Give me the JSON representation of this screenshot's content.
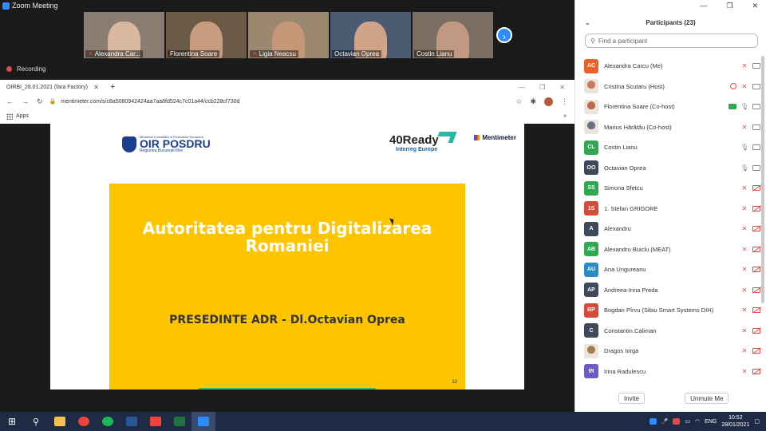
{
  "window": {
    "title": "Zoom Meeting"
  },
  "thumbnails": [
    {
      "name": "Alexandra Car...",
      "muted": true,
      "bg": "#8a7d70",
      "face": "#d9b8a0"
    },
    {
      "name": "Florentina Soare",
      "muted": false,
      "bg": "#6b5a48",
      "face": "#c89c7e"
    },
    {
      "name": "Ligia Neacsu",
      "muted": true,
      "bg": "#9c8870",
      "face": "#c49876"
    },
    {
      "name": "Octavian Oprea",
      "muted": false,
      "bg": "#4a5a70",
      "face": "#d0a489"
    },
    {
      "name": "Costin Lianu",
      "muted": false,
      "bg": "#7a6e62",
      "face": "#c09a80"
    }
  ],
  "recording": {
    "label": "Recording"
  },
  "browser": {
    "tab_title": "OIRBI_28.01.2021 (fara Factory)",
    "url": "mentimeter.com/s/c8a5080942424aa7aa8fd524c7c01a44/ccb228cf730d",
    "bookmarks_apps": "Apps"
  },
  "slide": {
    "oir_top": "Ministerul Investițiilor și Proiectelor Europene",
    "oir_title": "OIR POSDRU",
    "oir_sub": "Regiunea București Ilfov",
    "logo_40": "40Ready",
    "logo_40_sub": "Interreg Europe",
    "logo_menti": "Mentimeter",
    "heading_line1": "Autoritatea pentru Digitalizarea",
    "heading_line2": "Romaniei",
    "subheading": "PRESEDINTE ADR - Dl.Octavian Oprea",
    "page_number": "12"
  },
  "participants_panel": {
    "title": "Participants (23)",
    "search_placeholder": "Find a participant",
    "invite_label": "Invite",
    "unmute_label": "Unmute Me",
    "participants": [
      {
        "initials": "AC",
        "color": "#e8632b",
        "name": "Alexandra Carcu (Me)",
        "photo": false,
        "status": "muted",
        "cam": "on"
      },
      {
        "initials": "",
        "color": "#c47c5a",
        "name": "Cristina Scutaru (Host)",
        "photo": true,
        "status": "rec",
        "cam": "on"
      },
      {
        "initials": "",
        "color": "#b86b4e",
        "name": "Florentina Soare (Co-host)",
        "photo": true,
        "status": "screen",
        "cam": "on"
      },
      {
        "initials": "",
        "color": "#6a6f80",
        "name": "Marius Hărătău (Co-host)",
        "photo": true,
        "status": "muted",
        "cam": "on"
      },
      {
        "initials": "CL",
        "color": "#2fa84f",
        "name": "Costin Lianu",
        "photo": false,
        "status": "mic",
        "cam": "on"
      },
      {
        "initials": "OO",
        "color": "#3d4a5c",
        "name": "Octavian Oprea",
        "photo": false,
        "status": "mic",
        "cam": "on"
      },
      {
        "initials": "SS",
        "color": "#2fa84f",
        "name": "Simona Sfetcu",
        "photo": false,
        "status": "muted",
        "cam": "off"
      },
      {
        "initials": "1S",
        "color": "#d24b3b",
        "name": "1. Stefan GRIGORE",
        "photo": false,
        "status": "muted",
        "cam": "off"
      },
      {
        "initials": "A",
        "color": "#3d4a5c",
        "name": "Alexandru",
        "photo": false,
        "status": "muted",
        "cam": "off"
      },
      {
        "initials": "AB",
        "color": "#2fa84f",
        "name": "Alexandru Buiclu (MEAT)",
        "photo": false,
        "status": "muted",
        "cam": "off"
      },
      {
        "initials": "AU",
        "color": "#2b8cc4",
        "name": "Ana Ungureanu",
        "photo": false,
        "status": "muted",
        "cam": "off"
      },
      {
        "initials": "AP",
        "color": "#3d4a5c",
        "name": "Andreea-Irina Preda",
        "photo": false,
        "status": "muted",
        "cam": "off"
      },
      {
        "initials": "BP",
        "color": "#d24b3b",
        "name": "Bogdan Pîrvu (Sibiu Smart Systems DIH)",
        "photo": false,
        "status": "muted",
        "cam": "off"
      },
      {
        "initials": "C",
        "color": "#3d4a5c",
        "name": "Constantin.Caliman",
        "photo": false,
        "status": "muted",
        "cam": "off"
      },
      {
        "initials": "",
        "color": "#a57a50",
        "name": "Dragos Iorga",
        "photo": true,
        "status": "muted",
        "cam": "off"
      },
      {
        "initials": "IR",
        "color": "#6b5bc4",
        "name": "Irina Radulescu",
        "photo": false,
        "status": "muted",
        "cam": "off"
      }
    ]
  },
  "taskbar": {
    "apps": [
      {
        "name": "file-explorer",
        "color": "#f2c14e"
      },
      {
        "name": "chrome",
        "color": "#e8453c"
      },
      {
        "name": "spotify",
        "color": "#1db954"
      },
      {
        "name": "word",
        "color": "#2b579a"
      },
      {
        "name": "anydesk",
        "color": "#ef443b"
      },
      {
        "name": "excel",
        "color": "#217346"
      },
      {
        "name": "zoom",
        "color": "#2d8cff"
      }
    ],
    "language": "ENG",
    "time": "10:52",
    "date": "28/01/2021"
  }
}
